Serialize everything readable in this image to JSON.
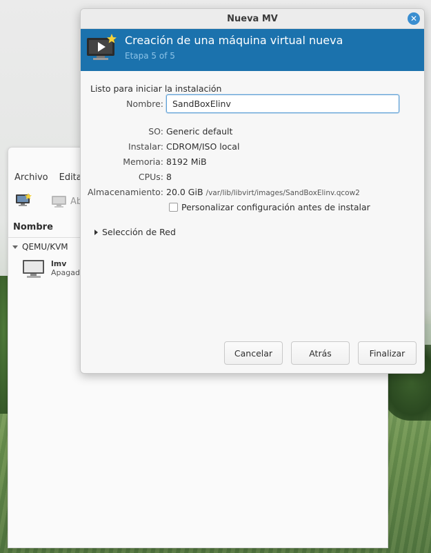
{
  "dialog": {
    "title": "Nueva MV",
    "close_icon": "close-icon",
    "banner_title": "Creación de una máquina virtual nueva",
    "banner_subtitle": "Etapa 5 of 5",
    "ready_text": "Listo para iniciar la instalación",
    "fields": {
      "name_label": "Nombre:",
      "name_value": "SandBoxElinv",
      "os_label": "SO:",
      "os_value": "Generic default",
      "install_label": "Instalar:",
      "install_value": "CDROM/ISO local",
      "memory_label": "Memoria:",
      "memory_value": "8192 MiB",
      "cpus_label": "CPUs:",
      "cpus_value": "8",
      "storage_label": "Almacenamiento:",
      "storage_value": "20.0 GiB",
      "storage_path": "/var/lib/libvirt/images/SandBoxElinv.qcow2"
    },
    "customize_label": "Personalizar configuración antes de instalar",
    "customize_checked": false,
    "network_expander": "Selección de Red",
    "buttons": {
      "cancel": "Cancelar",
      "back": "Atrás",
      "finish": "Finalizar"
    },
    "accent_color": "#1b72ad"
  },
  "main_window": {
    "menu": [
      "Archivo",
      "Editar"
    ],
    "toolbar_open_label": "Ab",
    "column_header": "Nombre",
    "group": "QEMU/KVM",
    "vm": {
      "name": "lmv",
      "state": "Apagado"
    }
  }
}
